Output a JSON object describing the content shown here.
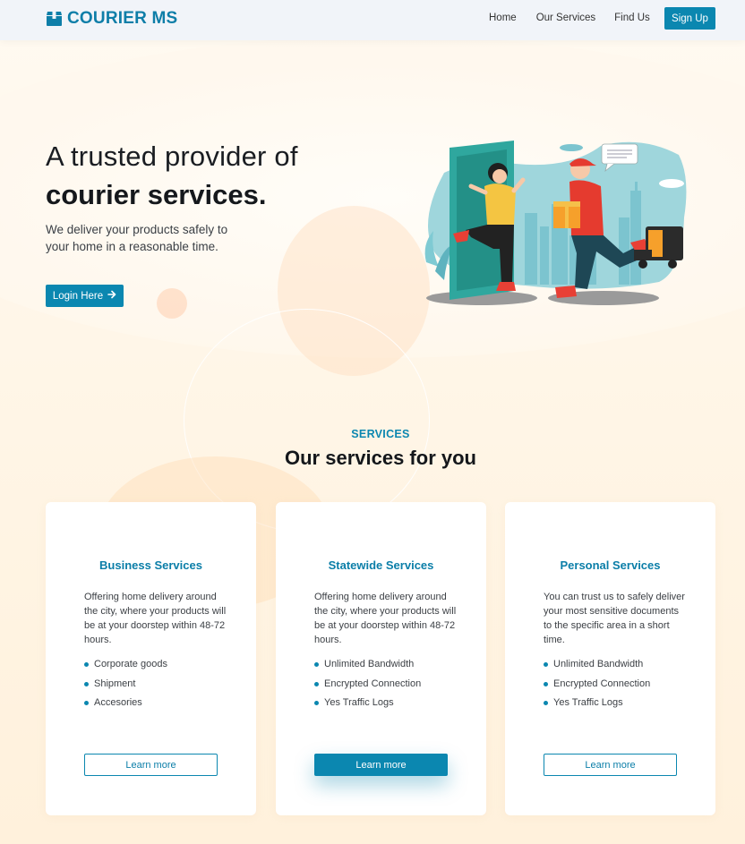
{
  "brand": {
    "name": "COURIER MS",
    "icon": "box-icon",
    "color": "#0e7ea8"
  },
  "nav": {
    "links": [
      "Home",
      "Our Services",
      "Find Us"
    ],
    "signup_label": "Sign Up"
  },
  "hero": {
    "title_line1": "A trusted provider of",
    "title_line2": "courier services.",
    "subtitle": "We deliver your products safely to your home in a reasonable time.",
    "login_label": "Login Here",
    "login_icon": "arrow-right-icon",
    "illustration": "courier-delivery-illustration"
  },
  "services": {
    "eyebrow": "SERVICES",
    "title": "Our services for you",
    "cards": [
      {
        "title": "Business Services",
        "description": "Offering home delivery around the city, where your products will be at your doorstep within 48-72 hours.",
        "items": [
          "Corporate goods",
          "Shipment",
          "Accesories"
        ],
        "button": "Learn more"
      },
      {
        "title": "Statewide Services",
        "description": "Offering home delivery around the city, where your products will be at your doorstep within 48-72 hours.",
        "items": [
          "Unlimited Bandwidth",
          "Encrypted Connection",
          "Yes Traffic Logs"
        ],
        "button": "Learn more"
      },
      {
        "title": "Personal Services",
        "description": "You can trust us to safely deliver your most sensitive documents to the specific area in a short time.",
        "items": [
          "Unlimited Bandwidth",
          "Encrypted Connection",
          "Yes Traffic Logs"
        ],
        "button": "Learn more"
      }
    ]
  },
  "colors": {
    "accent": "#0b87b0",
    "background": "#fff3e0"
  }
}
